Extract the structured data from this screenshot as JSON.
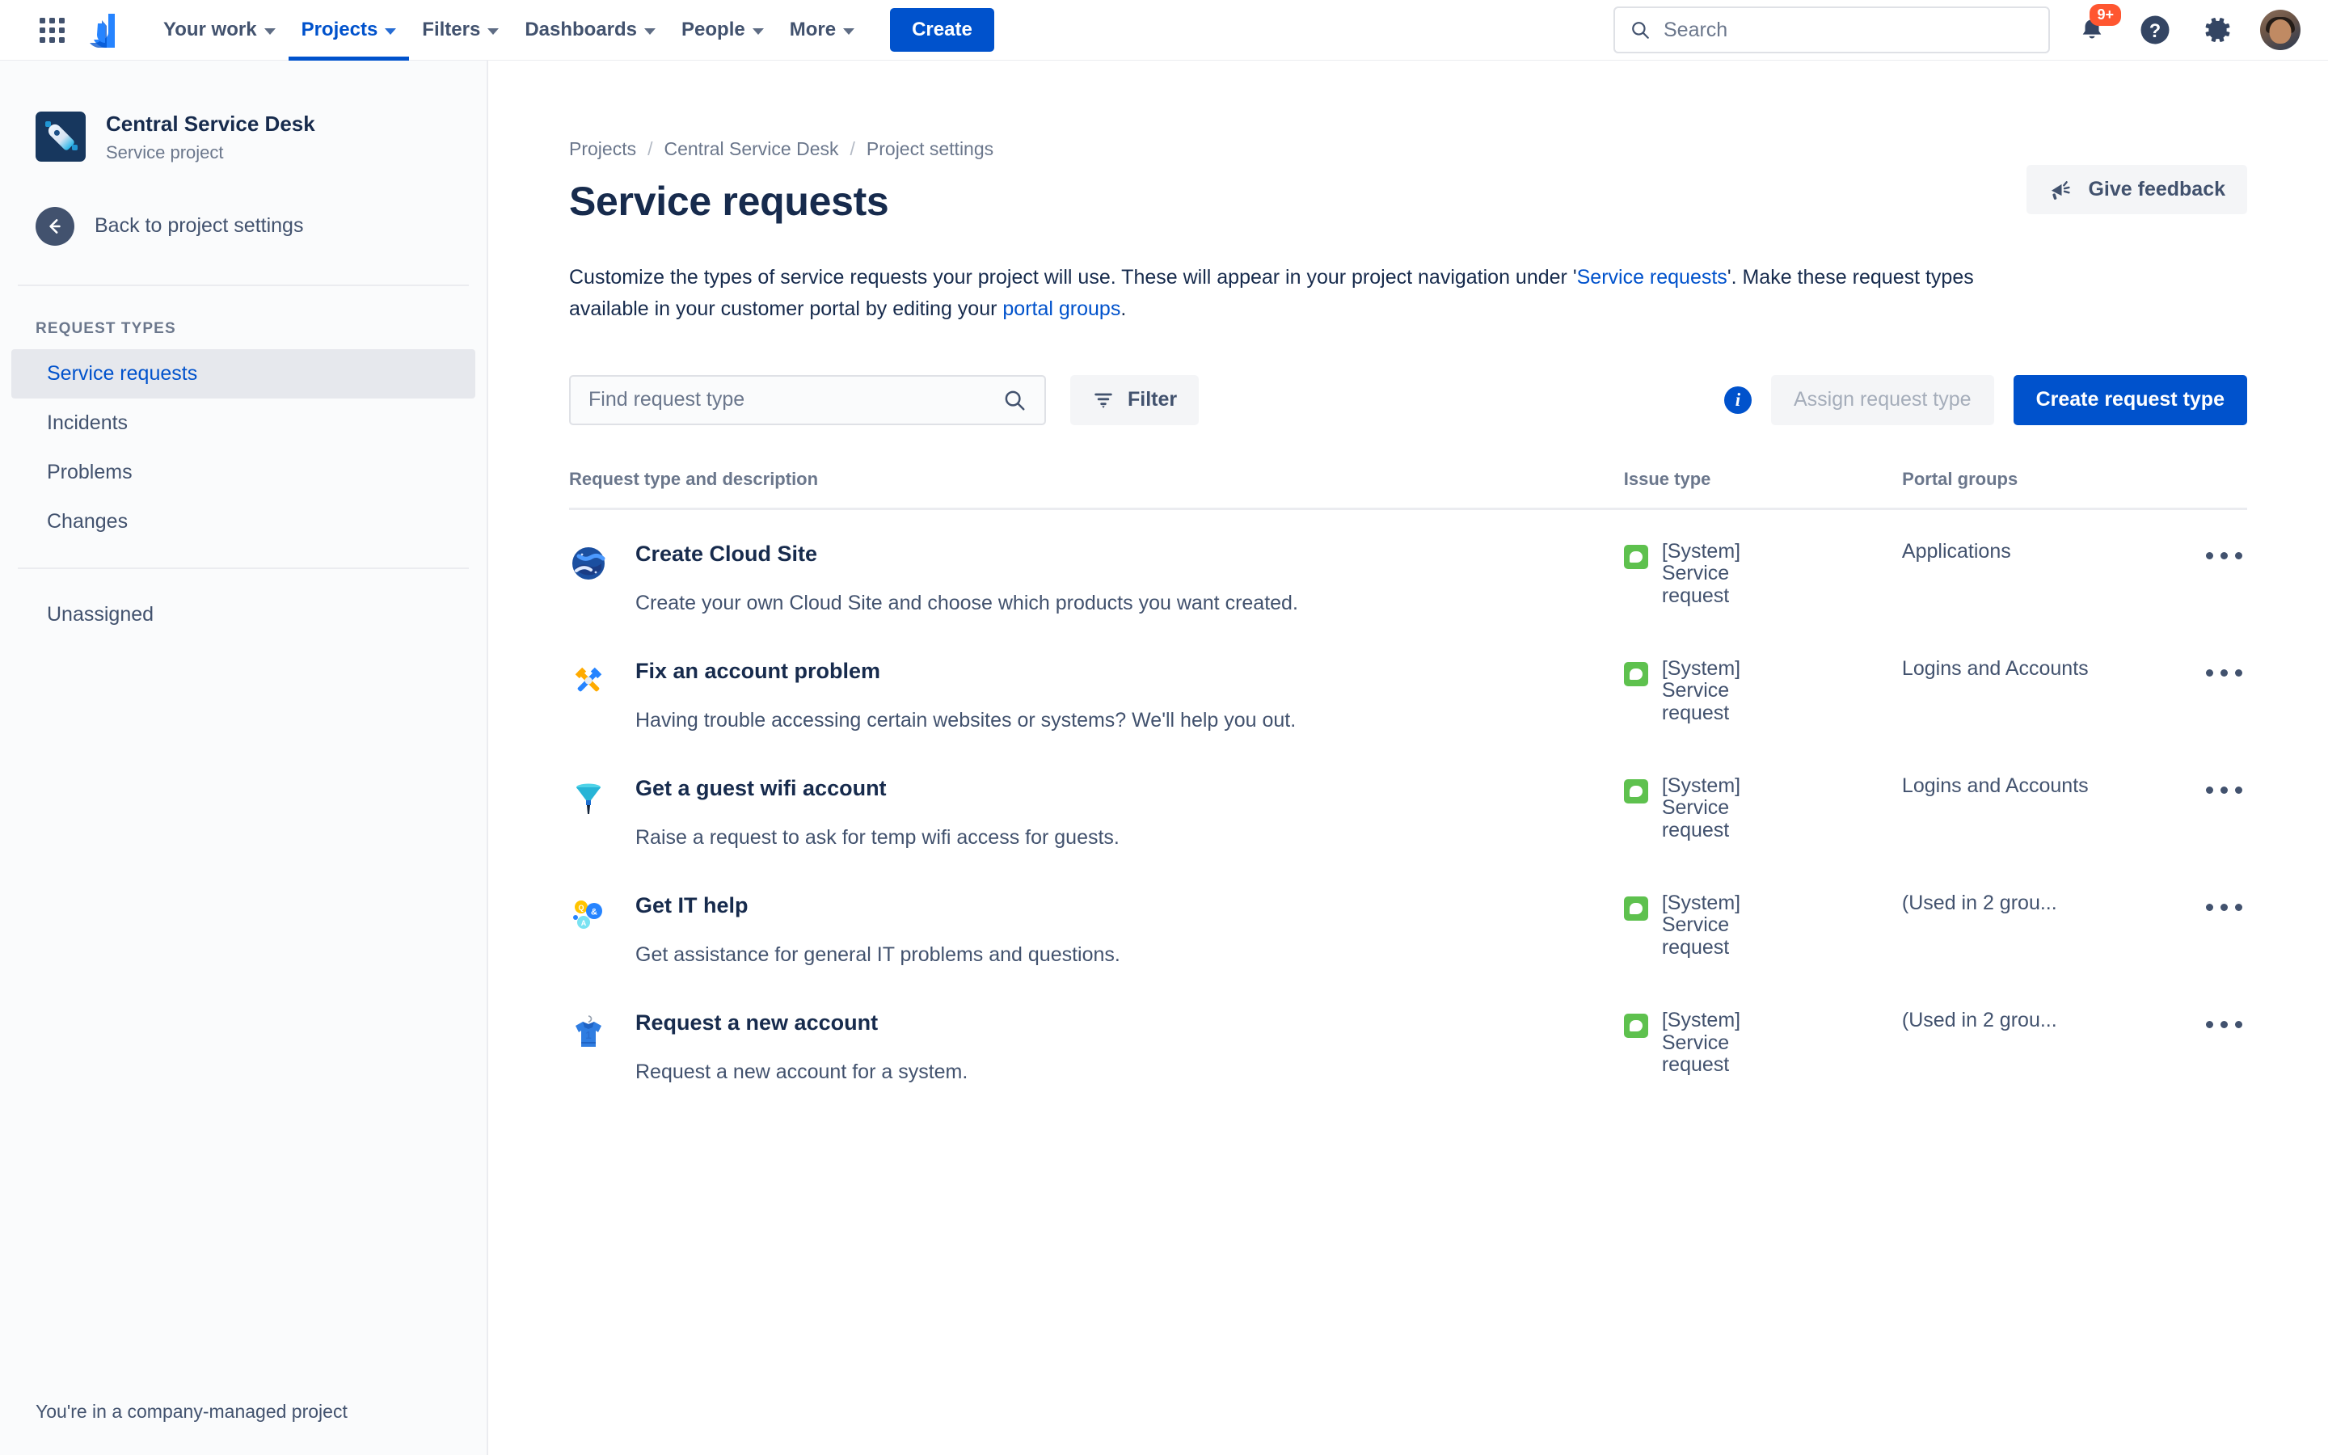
{
  "topnav": {
    "app_switcher_icon": "grid-apps-icon",
    "logo_icon": "jira-logo-icon",
    "items": [
      {
        "label": "Your work",
        "has_caret": true,
        "active": false
      },
      {
        "label": "Projects",
        "has_caret": true,
        "active": true
      },
      {
        "label": "Filters",
        "has_caret": true,
        "active": false
      },
      {
        "label": "Dashboards",
        "has_caret": true,
        "active": false
      },
      {
        "label": "People",
        "has_caret": true,
        "active": false
      },
      {
        "label": "More",
        "has_caret": true,
        "active": false
      }
    ],
    "create_label": "Create",
    "search_placeholder": "Search",
    "notification_badge": "9+",
    "help_glyph": "?",
    "accent_color": "#0052cc",
    "badge_color": "#ff5630"
  },
  "sidebar": {
    "project_name": "Central Service Desk",
    "project_type": "Service project",
    "project_icon": "rocket-icon",
    "back_label": "Back to project settings",
    "section_title": "REQUEST TYPES",
    "items": [
      {
        "label": "Service requests",
        "selected": true
      },
      {
        "label": "Incidents",
        "selected": false
      },
      {
        "label": "Problems",
        "selected": false
      },
      {
        "label": "Changes",
        "selected": false
      }
    ],
    "items_secondary": [
      {
        "label": "Unassigned",
        "selected": false
      }
    ],
    "footer": "You're in a company-managed project"
  },
  "main": {
    "breadcrumb": [
      {
        "label": "Projects"
      },
      {
        "label": "Central Service Desk"
      },
      {
        "label": "Project settings"
      }
    ],
    "breadcrumb_separator": "/",
    "page_title": "Service requests",
    "feedback_label": "Give feedback",
    "feedback_icon": "megaphone-icon",
    "description": {
      "part1": "Customize the types of service requests your project will use. These will appear in your project navigation under '",
      "link1": "Service requests",
      "part2": "'. Make these request types available in your customer portal by editing your ",
      "link2": "portal groups",
      "part3": "."
    },
    "toolbar": {
      "find_placeholder": "Find request type",
      "search_icon": "search-icon",
      "filter_label": "Filter",
      "filter_icon": "filter-icon",
      "info_icon": "info-icon",
      "assign_label": "Assign request type",
      "create_label": "Create request type"
    },
    "table": {
      "headers": {
        "request": "Request type and description",
        "issue_type": "Issue type",
        "portal_groups": "Portal groups",
        "actions": ""
      },
      "rows": [
        {
          "icon": "globe-cloud-icon",
          "name": "Create Cloud Site",
          "description": "Create your own Cloud Site and choose which products you want created.",
          "issue_type": "[System] Service request",
          "issue_type_icon": "service-request-icon",
          "portal_groups": "Applications",
          "actions_icon": "more-actions-icon"
        },
        {
          "icon": "tools-icon",
          "name": "Fix an account problem",
          "description": "Having trouble accessing certain websites or systems? We'll help you out.",
          "issue_type": "[System] Service request",
          "issue_type_icon": "service-request-icon",
          "portal_groups": "Logins and Accounts",
          "actions_icon": "more-actions-icon"
        },
        {
          "icon": "funnel-icon",
          "name": "Get a guest wifi account",
          "description": "Raise a request to ask for temp wifi access for guests.",
          "issue_type": "[System] Service request",
          "issue_type_icon": "service-request-icon",
          "portal_groups": "Logins and Accounts",
          "actions_icon": "more-actions-icon"
        },
        {
          "icon": "qa-bubbles-icon",
          "name": "Get IT help",
          "description": "Get assistance for general IT problems and questions.",
          "issue_type": "[System] Service request",
          "issue_type_icon": "service-request-icon",
          "portal_groups": "(Used in 2 grou...",
          "actions_icon": "more-actions-icon"
        },
        {
          "icon": "shirt-icon",
          "name": "Request a new account",
          "description": "Request a new account for a system.",
          "issue_type": "[System] Service request",
          "issue_type_icon": "service-request-icon",
          "portal_groups": "(Used in 2 grou...",
          "actions_icon": "more-actions-icon"
        }
      ]
    }
  },
  "colors": {
    "accent": "#0052cc",
    "text": "#172b4d",
    "subtle": "#6b778c",
    "issue_type_green": "#5ec14e",
    "badge_red": "#ff5630"
  }
}
